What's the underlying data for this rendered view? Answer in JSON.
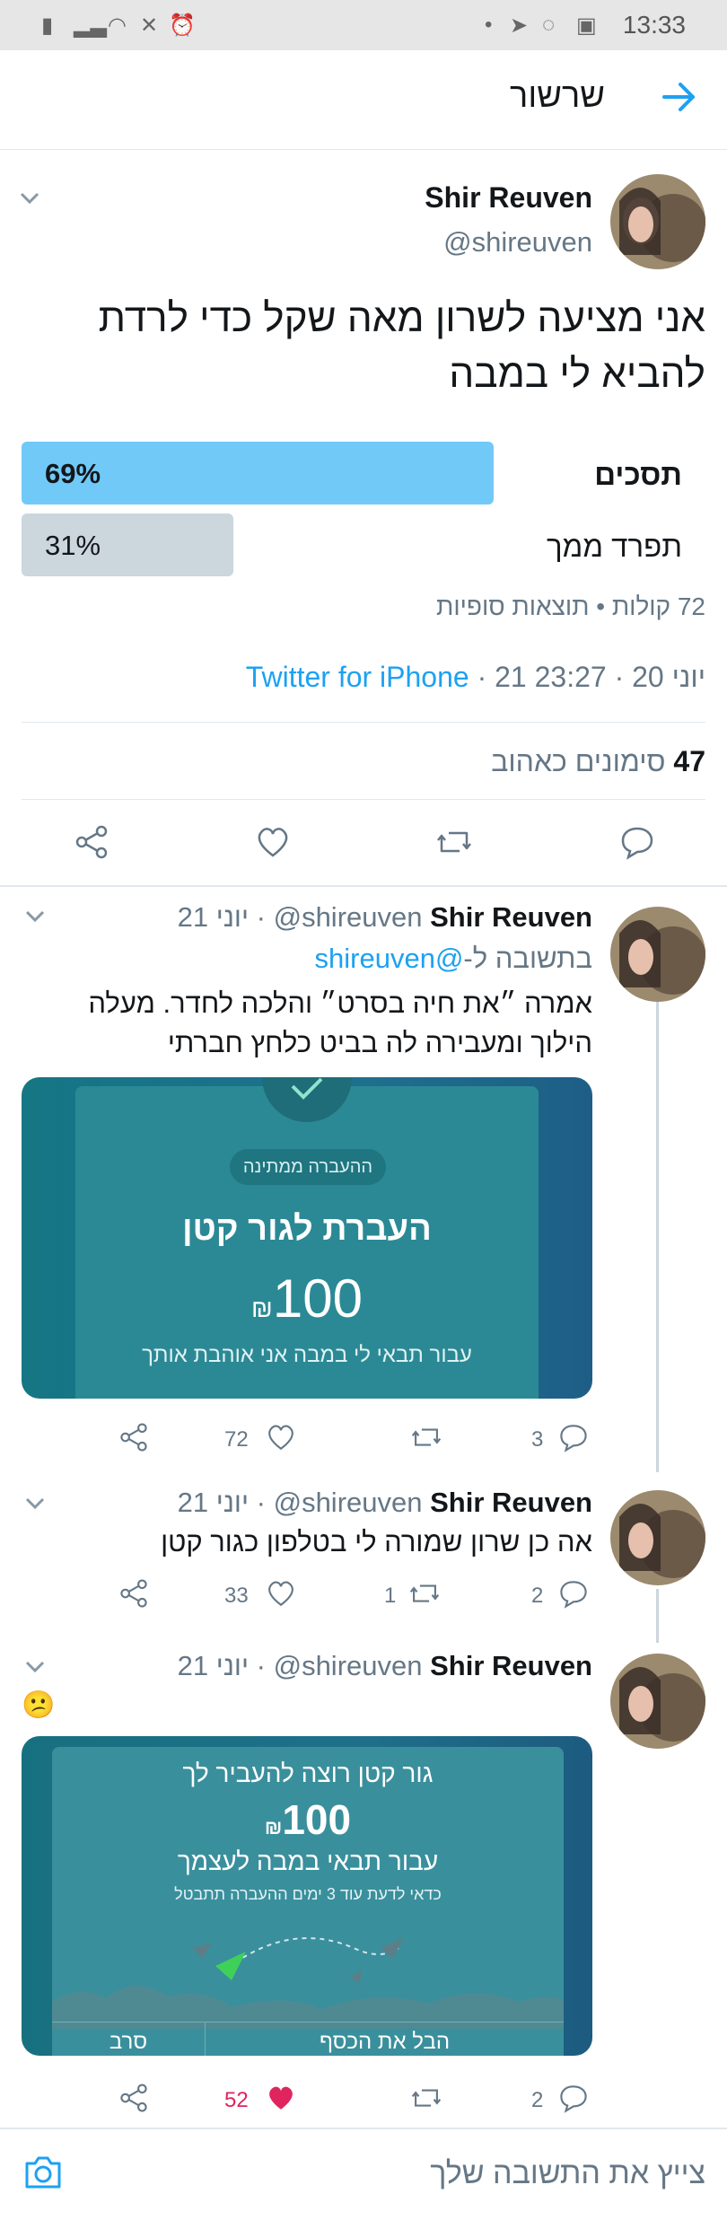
{
  "status_bar": {
    "time": "13:33"
  },
  "header": {
    "title": "שרשור"
  },
  "main_tweet": {
    "name": "Shir Reuven",
    "handle": "@shireuven",
    "text_line1": "אני מציעה לשרון מאה שקל כדי לרדת",
    "text_line2": "להביא לי במבה",
    "poll": {
      "options": [
        {
          "label": "תסכים",
          "percent_label": "69%",
          "percent": 69
        },
        {
          "label": "תפרד ממך",
          "percent_label": "31%",
          "percent": 31
        }
      ],
      "summary": "72 קולות • תוצאות סופיות"
    },
    "time": "23:27",
    "date": "21 יוני 20",
    "separator": "·",
    "source": "Twitter for iPhone",
    "likes_count": "47",
    "likes_label": "סימונים כאהוב"
  },
  "replies": [
    {
      "name": "Shir Reuven",
      "handle": "@shireuven",
      "date": "21 יוני",
      "reply_to_prefix": "בתשובה ל-",
      "reply_to_handle": "@shireuven",
      "text_line1": "אמרה ״את חיה בסרט״ והלכה לחדר. מעלה",
      "text_line2": "הילוך ומעבירה לה בביט כלחץ חברתי",
      "card": {
        "badge": "ההעברה ממתינה",
        "title": "העברת לגור קטן",
        "amount": "100",
        "currency": "₪",
        "note": "עבור תבאי לי במבה אני אוהבת אותך"
      },
      "comments": "3",
      "retweets": "",
      "likes": "72"
    },
    {
      "name": "Shir Reuven",
      "handle": "@shireuven",
      "date": "21 יוני",
      "text_line1": "אה כן שרון שמורה לי בטלפון כגור קטן",
      "comments": "2",
      "retweets": "1",
      "likes": "33"
    },
    {
      "name": "Shir Reuven",
      "handle": "@shireuven",
      "date": "21 יוני",
      "emoji": "😕",
      "card": {
        "title": "גור קטן רוצה להעביר לך",
        "amount": "100",
        "currency": "₪",
        "subtitle": "עבור תבאי במבה לעצמך",
        "note": "כדאי לדעת עוד 3 ימים ההעברה תתבטל",
        "btn_right": "הבל את הכסף",
        "btn_left": "סרב"
      },
      "comments": "2",
      "retweets": "",
      "likes": "52"
    }
  ],
  "reply_bar": {
    "placeholder": "צייץ את התשובה שלך"
  },
  "colors": {
    "accent": "#1da1f2",
    "poll_winner": "#71c9f8",
    "poll_other": "#ccd6dd",
    "like_red": "#e0245e",
    "card_teal": "#1b7e8c"
  }
}
